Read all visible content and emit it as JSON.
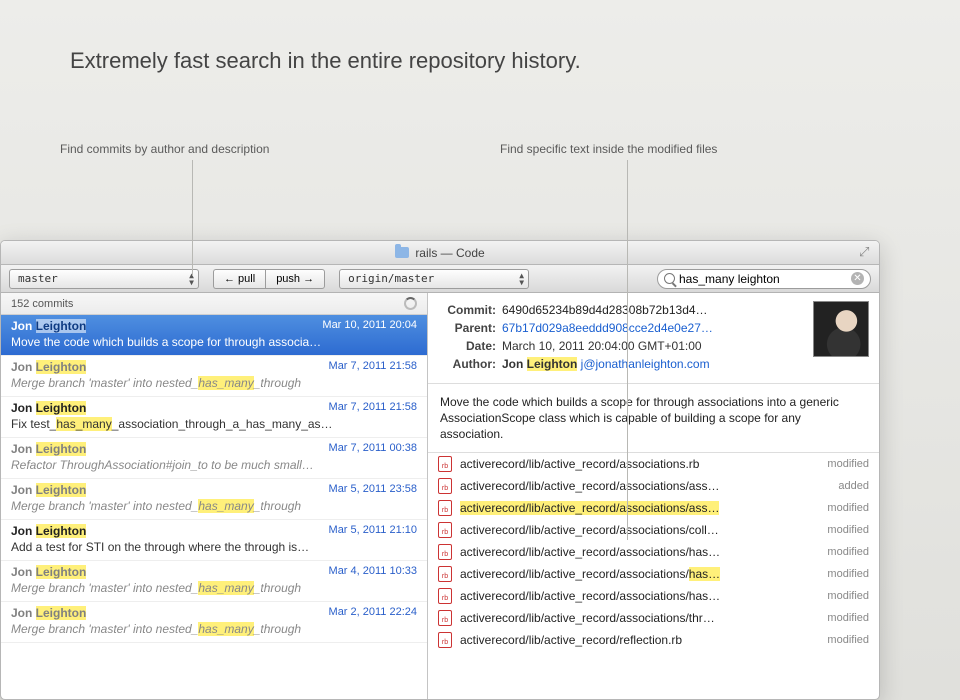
{
  "headline": "Extremely fast search in the entire repository history.",
  "callouts": {
    "left": "Find commits by author and description",
    "right": "Find specific text inside the modified files"
  },
  "window_title": "rails — Code",
  "toolbar": {
    "branch": "master",
    "remote": "origin/master",
    "pull_label": "← pull",
    "push_label": "push →",
    "search_value": "has_many leighton"
  },
  "commit_count": "152 commits",
  "commits": [
    {
      "author_pre": "Jon ",
      "author_hl": "Leighton",
      "date": "Mar 10, 2011 20:04",
      "msg_parts": [
        "Move the code which builds a scope for through associa…"
      ],
      "selected": true
    },
    {
      "author_pre": "Jon ",
      "author_hl": "Leighton",
      "date": "Mar 7, 2011 21:58",
      "msg_parts": [
        "Merge branch 'master' into nested_",
        "has_many",
        "_through"
      ],
      "dim": true
    },
    {
      "author_pre": "Jon ",
      "author_hl": "Leighton",
      "date": "Mar 7, 2011 21:58",
      "msg_parts": [
        "Fix test_",
        "has_many",
        "_association_through_a_has_many_as…"
      ]
    },
    {
      "author_pre": "Jon ",
      "author_hl": "Leighton",
      "date": "Mar 7, 2011 00:38",
      "msg_parts": [
        "Refactor ThroughAssociation#join_to to be much small…"
      ],
      "dim": true
    },
    {
      "author_pre": "Jon ",
      "author_hl": "Leighton",
      "date": "Mar 5, 2011 23:58",
      "msg_parts": [
        "Merge branch 'master' into nested_",
        "has_many",
        "_through"
      ],
      "dim": true
    },
    {
      "author_pre": "Jon ",
      "author_hl": "Leighton",
      "date": "Mar 5, 2011 21:10",
      "msg_parts": [
        "Add a test for STI on the through where the through is…"
      ]
    },
    {
      "author_pre": "Jon ",
      "author_hl": "Leighton",
      "date": "Mar 4, 2011 10:33",
      "msg_parts": [
        "Merge branch 'master' into nested_",
        "has_many",
        "_through"
      ],
      "dim": true
    },
    {
      "author_pre": "Jon ",
      "author_hl": "Leighton",
      "date": "Mar 2, 2011 22:24",
      "msg_parts": [
        "Merge branch 'master' into nested_",
        "has_many",
        "_through"
      ],
      "dim": true
    }
  ],
  "detail": {
    "commit_label": "Commit:",
    "parent_label": "Parent:",
    "date_label": "Date:",
    "author_label": "Author:",
    "commit_sha": "6490d65234b89d4d28308b72b13d4…",
    "parent_sha": "67b17d029a8eeddd908cce2d4e0e27…",
    "date_value": "March 10, 2011 20:04:00  GMT+01:00",
    "author_pre": "Jon ",
    "author_hl": "Leighton",
    "author_email": "j@jonathanleighton.com",
    "message": "Move the code which builds a scope for through associations into a generic AssociationScope class which is capable of building a scope for any association."
  },
  "files": [
    {
      "path_parts": [
        "activerecord/lib/active_record/associations.rb"
      ],
      "status": "modified"
    },
    {
      "path_parts": [
        "activerecord/lib/active_record/associations/ass…"
      ],
      "status": "added"
    },
    {
      "path_parts": [
        "activerecord/lib/active_record/associations/ass…"
      ],
      "status": "modified",
      "hl_row": true
    },
    {
      "path_parts": [
        "activerecord/lib/active_record/associations/coll…"
      ],
      "status": "modified"
    },
    {
      "path_parts": [
        "activerecord/lib/active_record/associations/has…"
      ],
      "status": "modified"
    },
    {
      "path_parts": [
        "activerecord/lib/active_record/associations/",
        "has…"
      ],
      "status": "modified",
      "last_hl": true
    },
    {
      "path_parts": [
        "activerecord/lib/active_record/associations/has…"
      ],
      "status": "modified"
    },
    {
      "path_parts": [
        "activerecord/lib/active_record/associations/thr…"
      ],
      "status": "modified"
    },
    {
      "path_parts": [
        "activerecord/lib/active_record/reflection.rb"
      ],
      "status": "modified"
    }
  ]
}
